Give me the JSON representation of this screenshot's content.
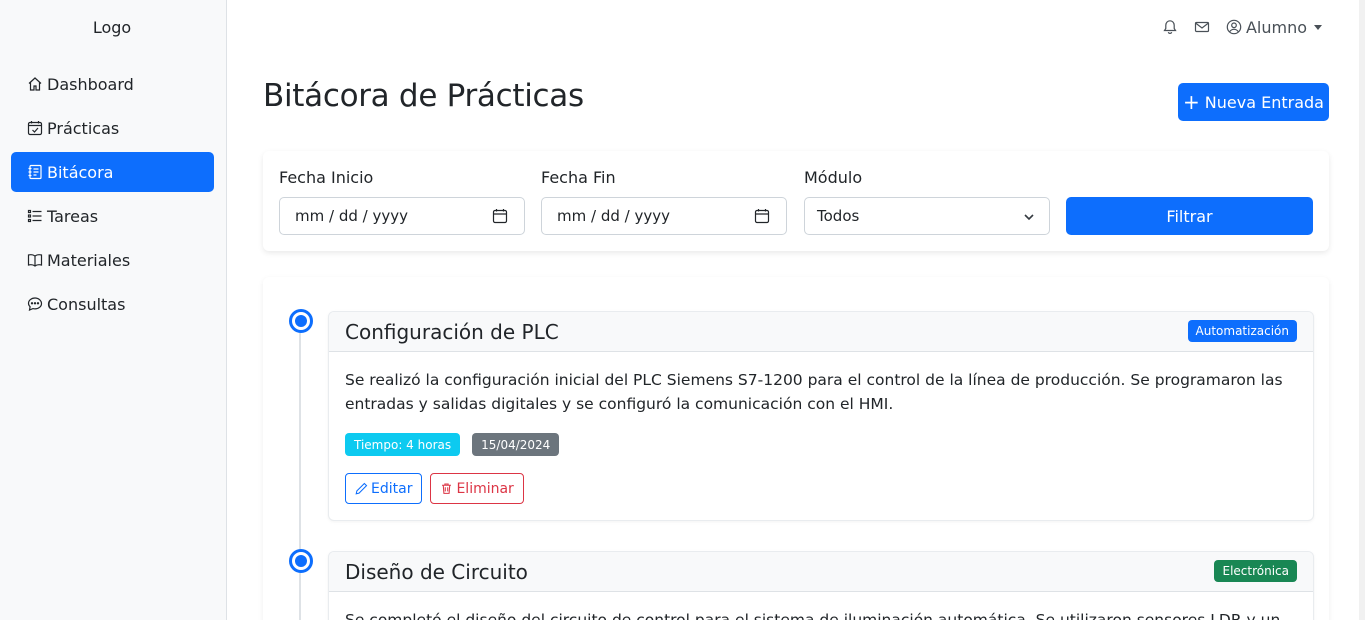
{
  "sidebar": {
    "logo": "Logo",
    "items": [
      {
        "label": "Dashboard",
        "icon": "house-icon",
        "active": false
      },
      {
        "label": "Prácticas",
        "icon": "calendar-check-icon",
        "active": false
      },
      {
        "label": "Bitácora",
        "icon": "journal-text-icon",
        "active": true
      },
      {
        "label": "Tareas",
        "icon": "list-task-icon",
        "active": false
      },
      {
        "label": "Materiales",
        "icon": "book-icon",
        "active": false
      },
      {
        "label": "Consultas",
        "icon": "chat-dots-icon",
        "active": false
      }
    ]
  },
  "topbar": {
    "user_label": "Alumno",
    "icons": [
      "bell-icon",
      "envelope-icon",
      "person-circle-icon"
    ]
  },
  "page": {
    "title": "Bitácora de Prácticas",
    "new_button": "Nueva Entrada"
  },
  "filters": {
    "start_label": "Fecha Inicio",
    "start_value": "mm / dd / yyyy",
    "end_label": "Fecha Fin",
    "end_value": "mm / dd / yyyy",
    "module_label": "Módulo",
    "module_value": "Todos",
    "filter_button": "Filtrar"
  },
  "entries": [
    {
      "title": "Configuración de PLC",
      "badge": "Automatización",
      "badge_color": "#0d6efd",
      "text": "Se realizó la configuración inicial del PLC Siemens S7-1200 para el control de la línea de producción. Se programaron las entradas y salidas digitales y se configuró la comunicación con el HMI.",
      "time": "Tiempo: 4 horas",
      "date": "15/04/2024",
      "edit": "Editar",
      "delete": "Eliminar"
    },
    {
      "title": "Diseño de Circuito",
      "badge": "Electrónica",
      "badge_color": "#198754",
      "text": "Se completó el diseño del circuito de control para el sistema de iluminación automática. Se utilizaron sensores LDR y un"
    }
  ],
  "colors": {
    "primary": "#0d6efd",
    "info": "#0dcaf0",
    "secondary": "#6c757d",
    "danger": "#dc3545",
    "success": "#198754"
  }
}
